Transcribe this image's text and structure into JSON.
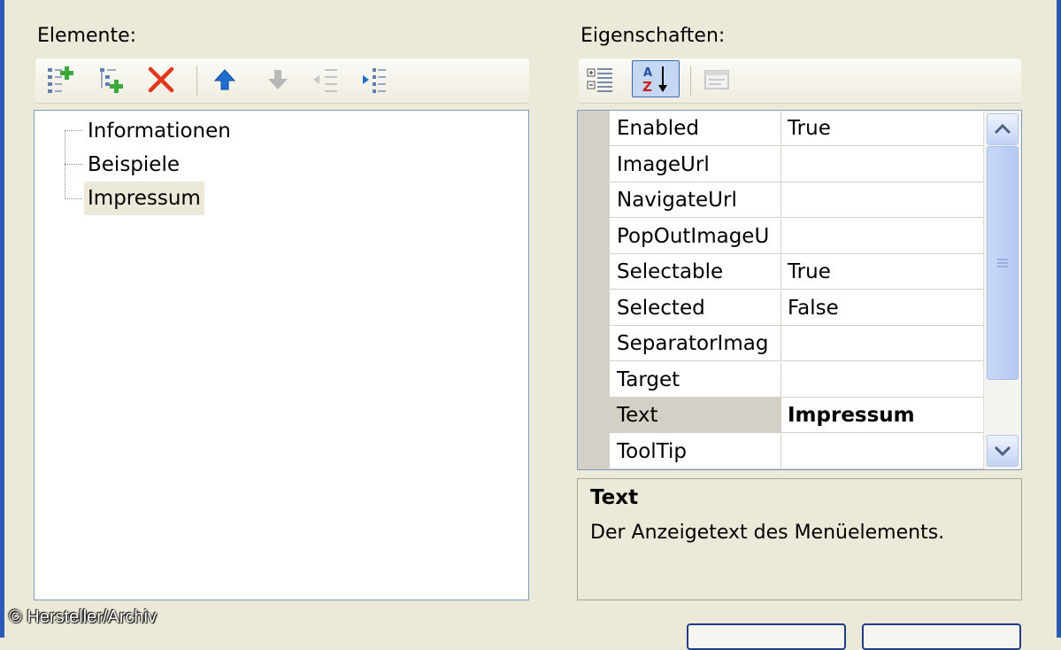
{
  "elements_panel": {
    "label": "Elemente:",
    "tree_items": [
      "Informationen",
      "Beispiele",
      "Impressum"
    ],
    "selected_index": 2
  },
  "toolbar_left": {
    "icons": [
      "add-root-item-icon",
      "add-child-item-icon",
      "delete-icon",
      "move-up-icon",
      "move-down-icon",
      "outdent-icon",
      "indent-icon"
    ]
  },
  "properties_panel": {
    "label": "Eigenschaften:",
    "toolbar_icons": [
      "categorized-icon",
      "alphabetical-sort-icon",
      "property-pages-icon"
    ],
    "rows": [
      {
        "name": "Enabled",
        "value": "True"
      },
      {
        "name": "ImageUrl",
        "value": ""
      },
      {
        "name": "NavigateUrl",
        "value": ""
      },
      {
        "name": "PopOutImageU",
        "value": ""
      },
      {
        "name": "Selectable",
        "value": "True"
      },
      {
        "name": "Selected",
        "value": "False"
      },
      {
        "name": "SeparatorImag",
        "value": ""
      },
      {
        "name": "Target",
        "value": ""
      },
      {
        "name": "Text",
        "value": "Impressum"
      },
      {
        "name": "ToolTip",
        "value": ""
      }
    ],
    "selected_row": 8
  },
  "description": {
    "title": "Text",
    "text": "Der Anzeigetext des Menüelements."
  },
  "copyright": "© Hersteller/Archiv",
  "colors": {
    "dialog_bg": "#ece9d8",
    "window_frame": "#2a5ab8",
    "selection_gray": "#d4d0c8",
    "delete_red": "#e2381c",
    "arrow_blue": "#1f6fd0"
  }
}
